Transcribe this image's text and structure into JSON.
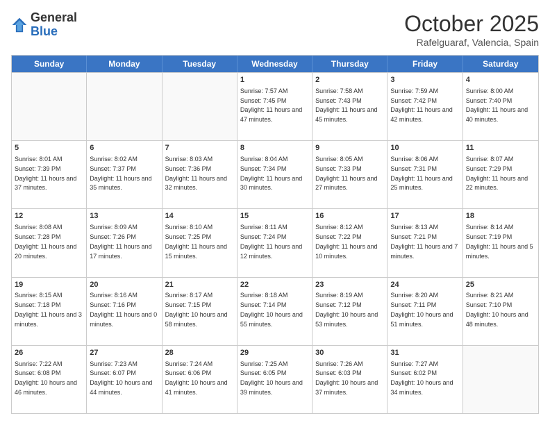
{
  "header": {
    "logo_general": "General",
    "logo_blue": "Blue",
    "month": "October 2025",
    "location": "Rafelguaraf, Valencia, Spain"
  },
  "days_of_week": [
    "Sunday",
    "Monday",
    "Tuesday",
    "Wednesday",
    "Thursday",
    "Friday",
    "Saturday"
  ],
  "weeks": [
    [
      {
        "day": "",
        "sunrise": "",
        "sunset": "",
        "daylight": "",
        "empty": true
      },
      {
        "day": "",
        "sunrise": "",
        "sunset": "",
        "daylight": "",
        "empty": true
      },
      {
        "day": "",
        "sunrise": "",
        "sunset": "",
        "daylight": "",
        "empty": true
      },
      {
        "day": "1",
        "sunrise": "Sunrise: 7:57 AM",
        "sunset": "Sunset: 7:45 PM",
        "daylight": "Daylight: 11 hours and 47 minutes.",
        "empty": false
      },
      {
        "day": "2",
        "sunrise": "Sunrise: 7:58 AM",
        "sunset": "Sunset: 7:43 PM",
        "daylight": "Daylight: 11 hours and 45 minutes.",
        "empty": false
      },
      {
        "day": "3",
        "sunrise": "Sunrise: 7:59 AM",
        "sunset": "Sunset: 7:42 PM",
        "daylight": "Daylight: 11 hours and 42 minutes.",
        "empty": false
      },
      {
        "day": "4",
        "sunrise": "Sunrise: 8:00 AM",
        "sunset": "Sunset: 7:40 PM",
        "daylight": "Daylight: 11 hours and 40 minutes.",
        "empty": false
      }
    ],
    [
      {
        "day": "5",
        "sunrise": "Sunrise: 8:01 AM",
        "sunset": "Sunset: 7:39 PM",
        "daylight": "Daylight: 11 hours and 37 minutes.",
        "empty": false
      },
      {
        "day": "6",
        "sunrise": "Sunrise: 8:02 AM",
        "sunset": "Sunset: 7:37 PM",
        "daylight": "Daylight: 11 hours and 35 minutes.",
        "empty": false
      },
      {
        "day": "7",
        "sunrise": "Sunrise: 8:03 AM",
        "sunset": "Sunset: 7:36 PM",
        "daylight": "Daylight: 11 hours and 32 minutes.",
        "empty": false
      },
      {
        "day": "8",
        "sunrise": "Sunrise: 8:04 AM",
        "sunset": "Sunset: 7:34 PM",
        "daylight": "Daylight: 11 hours and 30 minutes.",
        "empty": false
      },
      {
        "day": "9",
        "sunrise": "Sunrise: 8:05 AM",
        "sunset": "Sunset: 7:33 PM",
        "daylight": "Daylight: 11 hours and 27 minutes.",
        "empty": false
      },
      {
        "day": "10",
        "sunrise": "Sunrise: 8:06 AM",
        "sunset": "Sunset: 7:31 PM",
        "daylight": "Daylight: 11 hours and 25 minutes.",
        "empty": false
      },
      {
        "day": "11",
        "sunrise": "Sunrise: 8:07 AM",
        "sunset": "Sunset: 7:29 PM",
        "daylight": "Daylight: 11 hours and 22 minutes.",
        "empty": false
      }
    ],
    [
      {
        "day": "12",
        "sunrise": "Sunrise: 8:08 AM",
        "sunset": "Sunset: 7:28 PM",
        "daylight": "Daylight: 11 hours and 20 minutes.",
        "empty": false
      },
      {
        "day": "13",
        "sunrise": "Sunrise: 8:09 AM",
        "sunset": "Sunset: 7:26 PM",
        "daylight": "Daylight: 11 hours and 17 minutes.",
        "empty": false
      },
      {
        "day": "14",
        "sunrise": "Sunrise: 8:10 AM",
        "sunset": "Sunset: 7:25 PM",
        "daylight": "Daylight: 11 hours and 15 minutes.",
        "empty": false
      },
      {
        "day": "15",
        "sunrise": "Sunrise: 8:11 AM",
        "sunset": "Sunset: 7:24 PM",
        "daylight": "Daylight: 11 hours and 12 minutes.",
        "empty": false
      },
      {
        "day": "16",
        "sunrise": "Sunrise: 8:12 AM",
        "sunset": "Sunset: 7:22 PM",
        "daylight": "Daylight: 11 hours and 10 minutes.",
        "empty": false
      },
      {
        "day": "17",
        "sunrise": "Sunrise: 8:13 AM",
        "sunset": "Sunset: 7:21 PM",
        "daylight": "Daylight: 11 hours and 7 minutes.",
        "empty": false
      },
      {
        "day": "18",
        "sunrise": "Sunrise: 8:14 AM",
        "sunset": "Sunset: 7:19 PM",
        "daylight": "Daylight: 11 hours and 5 minutes.",
        "empty": false
      }
    ],
    [
      {
        "day": "19",
        "sunrise": "Sunrise: 8:15 AM",
        "sunset": "Sunset: 7:18 PM",
        "daylight": "Daylight: 11 hours and 3 minutes.",
        "empty": false
      },
      {
        "day": "20",
        "sunrise": "Sunrise: 8:16 AM",
        "sunset": "Sunset: 7:16 PM",
        "daylight": "Daylight: 11 hours and 0 minutes.",
        "empty": false
      },
      {
        "day": "21",
        "sunrise": "Sunrise: 8:17 AM",
        "sunset": "Sunset: 7:15 PM",
        "daylight": "Daylight: 10 hours and 58 minutes.",
        "empty": false
      },
      {
        "day": "22",
        "sunrise": "Sunrise: 8:18 AM",
        "sunset": "Sunset: 7:14 PM",
        "daylight": "Daylight: 10 hours and 55 minutes.",
        "empty": false
      },
      {
        "day": "23",
        "sunrise": "Sunrise: 8:19 AM",
        "sunset": "Sunset: 7:12 PM",
        "daylight": "Daylight: 10 hours and 53 minutes.",
        "empty": false
      },
      {
        "day": "24",
        "sunrise": "Sunrise: 8:20 AM",
        "sunset": "Sunset: 7:11 PM",
        "daylight": "Daylight: 10 hours and 51 minutes.",
        "empty": false
      },
      {
        "day": "25",
        "sunrise": "Sunrise: 8:21 AM",
        "sunset": "Sunset: 7:10 PM",
        "daylight": "Daylight: 10 hours and 48 minutes.",
        "empty": false
      }
    ],
    [
      {
        "day": "26",
        "sunrise": "Sunrise: 7:22 AM",
        "sunset": "Sunset: 6:08 PM",
        "daylight": "Daylight: 10 hours and 46 minutes.",
        "empty": false
      },
      {
        "day": "27",
        "sunrise": "Sunrise: 7:23 AM",
        "sunset": "Sunset: 6:07 PM",
        "daylight": "Daylight: 10 hours and 44 minutes.",
        "empty": false
      },
      {
        "day": "28",
        "sunrise": "Sunrise: 7:24 AM",
        "sunset": "Sunset: 6:06 PM",
        "daylight": "Daylight: 10 hours and 41 minutes.",
        "empty": false
      },
      {
        "day": "29",
        "sunrise": "Sunrise: 7:25 AM",
        "sunset": "Sunset: 6:05 PM",
        "daylight": "Daylight: 10 hours and 39 minutes.",
        "empty": false
      },
      {
        "day": "30",
        "sunrise": "Sunrise: 7:26 AM",
        "sunset": "Sunset: 6:03 PM",
        "daylight": "Daylight: 10 hours and 37 minutes.",
        "empty": false
      },
      {
        "day": "31",
        "sunrise": "Sunrise: 7:27 AM",
        "sunset": "Sunset: 6:02 PM",
        "daylight": "Daylight: 10 hours and 34 minutes.",
        "empty": false
      },
      {
        "day": "",
        "sunrise": "",
        "sunset": "",
        "daylight": "",
        "empty": true
      }
    ]
  ]
}
